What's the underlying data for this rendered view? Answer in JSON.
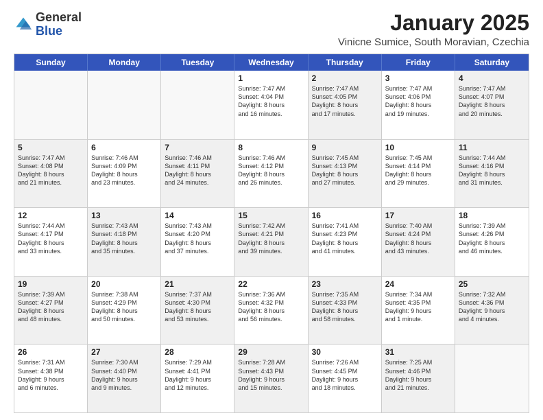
{
  "logo": {
    "general": "General",
    "blue": "Blue"
  },
  "header": {
    "month": "January 2025",
    "location": "Vinicne Sumice, South Moravian, Czechia"
  },
  "weekdays": [
    "Sunday",
    "Monday",
    "Tuesday",
    "Wednesday",
    "Thursday",
    "Friday",
    "Saturday"
  ],
  "weeks": [
    [
      {
        "day": "",
        "info": "",
        "empty": true
      },
      {
        "day": "",
        "info": "",
        "empty": true
      },
      {
        "day": "",
        "info": "",
        "empty": true
      },
      {
        "day": "1",
        "info": "Sunrise: 7:47 AM\nSunset: 4:04 PM\nDaylight: 8 hours\nand 16 minutes.",
        "shaded": false
      },
      {
        "day": "2",
        "info": "Sunrise: 7:47 AM\nSunset: 4:05 PM\nDaylight: 8 hours\nand 17 minutes.",
        "shaded": true
      },
      {
        "day": "3",
        "info": "Sunrise: 7:47 AM\nSunset: 4:06 PM\nDaylight: 8 hours\nand 19 minutes.",
        "shaded": false
      },
      {
        "day": "4",
        "info": "Sunrise: 7:47 AM\nSunset: 4:07 PM\nDaylight: 8 hours\nand 20 minutes.",
        "shaded": true
      }
    ],
    [
      {
        "day": "5",
        "info": "Sunrise: 7:47 AM\nSunset: 4:08 PM\nDaylight: 8 hours\nand 21 minutes.",
        "shaded": true
      },
      {
        "day": "6",
        "info": "Sunrise: 7:46 AM\nSunset: 4:09 PM\nDaylight: 8 hours\nand 23 minutes.",
        "shaded": false
      },
      {
        "day": "7",
        "info": "Sunrise: 7:46 AM\nSunset: 4:11 PM\nDaylight: 8 hours\nand 24 minutes.",
        "shaded": true
      },
      {
        "day": "8",
        "info": "Sunrise: 7:46 AM\nSunset: 4:12 PM\nDaylight: 8 hours\nand 26 minutes.",
        "shaded": false
      },
      {
        "day": "9",
        "info": "Sunrise: 7:45 AM\nSunset: 4:13 PM\nDaylight: 8 hours\nand 27 minutes.",
        "shaded": true
      },
      {
        "day": "10",
        "info": "Sunrise: 7:45 AM\nSunset: 4:14 PM\nDaylight: 8 hours\nand 29 minutes.",
        "shaded": false
      },
      {
        "day": "11",
        "info": "Sunrise: 7:44 AM\nSunset: 4:16 PM\nDaylight: 8 hours\nand 31 minutes.",
        "shaded": true
      }
    ],
    [
      {
        "day": "12",
        "info": "Sunrise: 7:44 AM\nSunset: 4:17 PM\nDaylight: 8 hours\nand 33 minutes.",
        "shaded": false
      },
      {
        "day": "13",
        "info": "Sunrise: 7:43 AM\nSunset: 4:18 PM\nDaylight: 8 hours\nand 35 minutes.",
        "shaded": true
      },
      {
        "day": "14",
        "info": "Sunrise: 7:43 AM\nSunset: 4:20 PM\nDaylight: 8 hours\nand 37 minutes.",
        "shaded": false
      },
      {
        "day": "15",
        "info": "Sunrise: 7:42 AM\nSunset: 4:21 PM\nDaylight: 8 hours\nand 39 minutes.",
        "shaded": true
      },
      {
        "day": "16",
        "info": "Sunrise: 7:41 AM\nSunset: 4:23 PM\nDaylight: 8 hours\nand 41 minutes.",
        "shaded": false
      },
      {
        "day": "17",
        "info": "Sunrise: 7:40 AM\nSunset: 4:24 PM\nDaylight: 8 hours\nand 43 minutes.",
        "shaded": true
      },
      {
        "day": "18",
        "info": "Sunrise: 7:39 AM\nSunset: 4:26 PM\nDaylight: 8 hours\nand 46 minutes.",
        "shaded": false
      }
    ],
    [
      {
        "day": "19",
        "info": "Sunrise: 7:39 AM\nSunset: 4:27 PM\nDaylight: 8 hours\nand 48 minutes.",
        "shaded": true
      },
      {
        "day": "20",
        "info": "Sunrise: 7:38 AM\nSunset: 4:29 PM\nDaylight: 8 hours\nand 50 minutes.",
        "shaded": false
      },
      {
        "day": "21",
        "info": "Sunrise: 7:37 AM\nSunset: 4:30 PM\nDaylight: 8 hours\nand 53 minutes.",
        "shaded": true
      },
      {
        "day": "22",
        "info": "Sunrise: 7:36 AM\nSunset: 4:32 PM\nDaylight: 8 hours\nand 56 minutes.",
        "shaded": false
      },
      {
        "day": "23",
        "info": "Sunrise: 7:35 AM\nSunset: 4:33 PM\nDaylight: 8 hours\nand 58 minutes.",
        "shaded": true
      },
      {
        "day": "24",
        "info": "Sunrise: 7:34 AM\nSunset: 4:35 PM\nDaylight: 9 hours\nand 1 minute.",
        "shaded": false
      },
      {
        "day": "25",
        "info": "Sunrise: 7:32 AM\nSunset: 4:36 PM\nDaylight: 9 hours\nand 4 minutes.",
        "shaded": true
      }
    ],
    [
      {
        "day": "26",
        "info": "Sunrise: 7:31 AM\nSunset: 4:38 PM\nDaylight: 9 hours\nand 6 minutes.",
        "shaded": false
      },
      {
        "day": "27",
        "info": "Sunrise: 7:30 AM\nSunset: 4:40 PM\nDaylight: 9 hours\nand 9 minutes.",
        "shaded": true
      },
      {
        "day": "28",
        "info": "Sunrise: 7:29 AM\nSunset: 4:41 PM\nDaylight: 9 hours\nand 12 minutes.",
        "shaded": false
      },
      {
        "day": "29",
        "info": "Sunrise: 7:28 AM\nSunset: 4:43 PM\nDaylight: 9 hours\nand 15 minutes.",
        "shaded": true
      },
      {
        "day": "30",
        "info": "Sunrise: 7:26 AM\nSunset: 4:45 PM\nDaylight: 9 hours\nand 18 minutes.",
        "shaded": false
      },
      {
        "day": "31",
        "info": "Sunrise: 7:25 AM\nSunset: 4:46 PM\nDaylight: 9 hours\nand 21 minutes.",
        "shaded": true
      },
      {
        "day": "",
        "info": "",
        "empty": true
      }
    ]
  ]
}
